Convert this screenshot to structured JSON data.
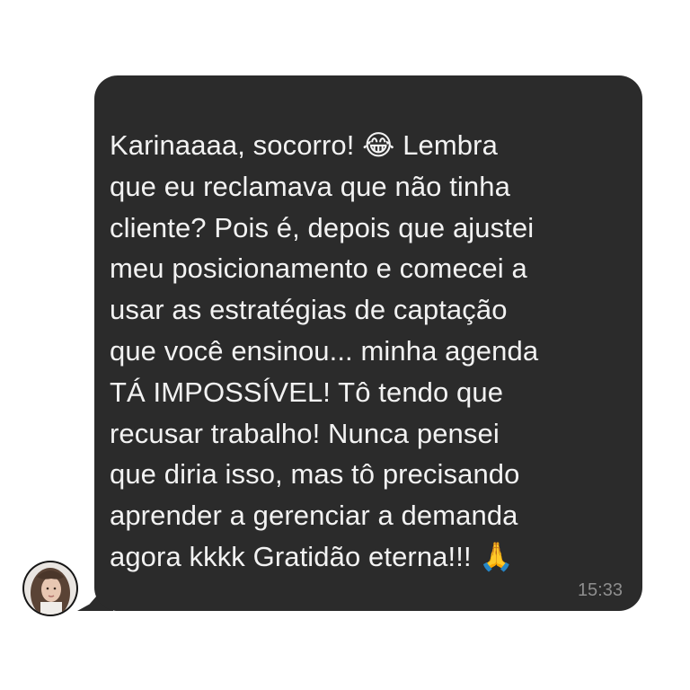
{
  "chat": {
    "message": {
      "text_before_emoji_1": "Karinaaaa, socorro! ",
      "emoji_1": "😂",
      "text_middle": " Lembra\nque eu reclamava que não tinha\ncliente? Pois é, depois que ajustei\nmeu posicionamento e comecei a\nusar as estratégias de captação\nque você ensinou... minha agenda\nTÁ IMPOSSÍVEL! Tô tendo que\nrecusar trabalho! Nunca pensei\nque diria isso, mas tô precisando\naprender a gerenciar a demanda\nagora kkkk Gratidão eterna!!! ",
      "emoji_2": "🙏",
      "timestamp": "15:33"
    },
    "sender": {
      "avatar_icon": "profile-photo-icon"
    }
  },
  "colors": {
    "bubble_background": "#2b2b2b",
    "message_text": "#f2f2f2",
    "timestamp_text": "#8e8e8e",
    "page_background": "#ffffff"
  }
}
